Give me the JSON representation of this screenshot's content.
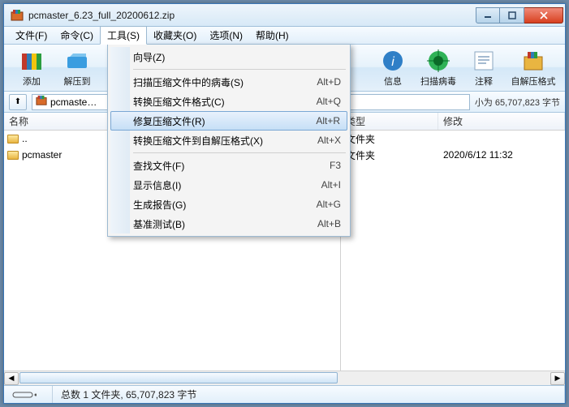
{
  "title": "pcmaster_6.23_full_20200612.zip",
  "menubar": [
    "文件(F)",
    "命令(C)",
    "工具(S)",
    "收藏夹(O)",
    "选项(N)",
    "帮助(H)"
  ],
  "menubar_open_index": 2,
  "toolbar": {
    "add": "添加",
    "extract": "解压到",
    "info": "信息",
    "scan": "扫描病毒",
    "comment": "注释",
    "sfx": "自解压格式"
  },
  "pathbar": {
    "filename": "pcmaster_6.23_full_20200612.zip",
    "right_status": "小为 65,707,823 字节"
  },
  "dropdown": {
    "wizard": "向导(Z)",
    "scan_virus": "扫描压缩文件中的病毒(S)",
    "convert": "转换压缩文件格式(C)",
    "repair": "修复压缩文件(R)",
    "to_sfx": "转换压缩文件到自解压格式(X)",
    "find": "查找文件(F)",
    "show_info": "显示信息(I)",
    "report": "生成报告(G)",
    "benchmark": "基准测试(B)",
    "sc": {
      "scan_virus": "Alt+D",
      "convert": "Alt+Q",
      "repair": "Alt+R",
      "to_sfx": "Alt+X",
      "find": "F3",
      "show_info": "Alt+I",
      "report": "Alt+G",
      "benchmark": "Alt+B"
    }
  },
  "columns": {
    "name": "名称",
    "type": "类型",
    "modified": "修改"
  },
  "rows_left": [
    {
      "name": ".."
    },
    {
      "name": "pcmaster"
    }
  ],
  "rows_right": [
    {
      "type": "文件夹",
      "modified": ""
    },
    {
      "type": "文件夹",
      "modified": "2020/6/12 11:32"
    }
  ],
  "statusbar": {
    "total": "总数 1 文件夹, 65,707,823 字节"
  }
}
